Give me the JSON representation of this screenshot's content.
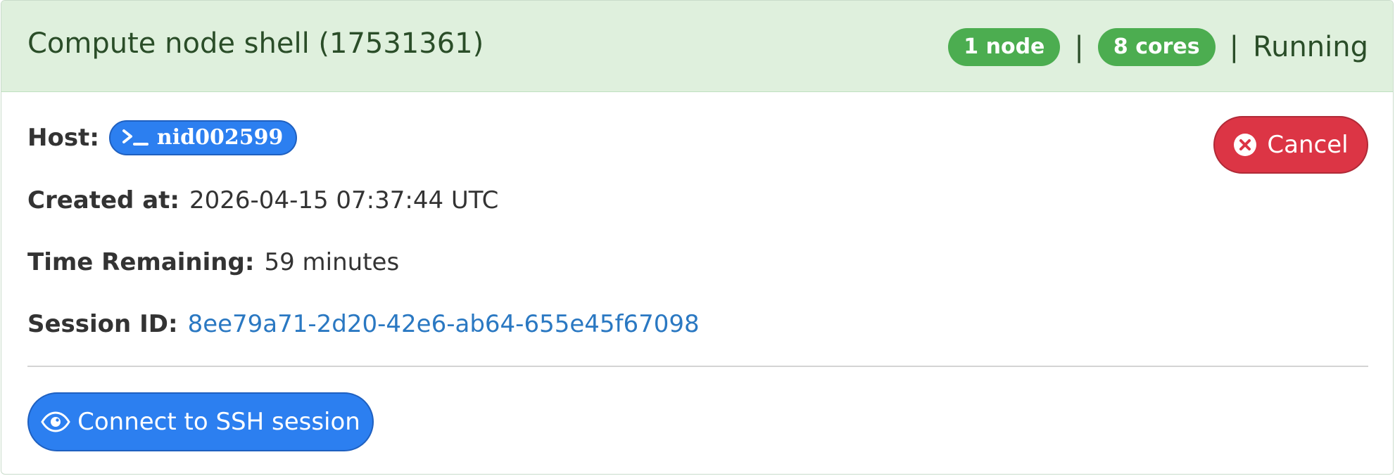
{
  "header": {
    "title": "Compute node shell (17531361)",
    "nodes_badge": "1 node",
    "separator": "|",
    "cores_badge": "8 cores",
    "status": "Running"
  },
  "details": {
    "host_label": "Host",
    "host_value": "nid002599",
    "created_label": "Created at",
    "created_value": "2026-04-15 07:37:44 UTC",
    "time_label": "Time Remaining",
    "time_value": "59 minutes",
    "session_label": "Session ID",
    "session_value": "8ee79a71-2d20-42e6-ab64-655e45f67098",
    "colon": ":"
  },
  "actions": {
    "cancel_label": "Cancel",
    "connect_label": "Connect to SSH session"
  },
  "icons": {
    "host": "terminal-icon",
    "cancel": "x-circle-icon",
    "connect": "eye-icon"
  },
  "colors": {
    "header_bg": "#dff0dd",
    "badge_green": "#4cad50",
    "primary_blue": "#2c7ff0",
    "danger_red": "#dc3545",
    "link_blue": "#2a78c2"
  }
}
